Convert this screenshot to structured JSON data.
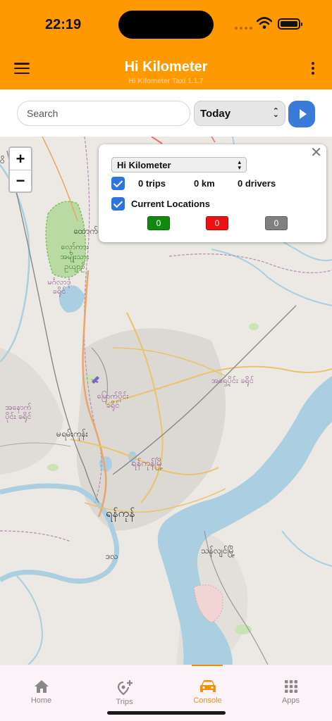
{
  "status_bar": {
    "time": "22:19"
  },
  "header": {
    "title": "Hi Kilometer",
    "subtitle": "Hi Kilometer Taxi 1.1.7"
  },
  "search": {
    "placeholder": "Search",
    "value": ""
  },
  "period": {
    "selected": "Today"
  },
  "map": {
    "zoom_in": "+",
    "zoom_out": "−",
    "labels": {
      "north": "ထောက်",
      "park": "လှော်ကား အမျိုးသား ဥယျာဉ်",
      "mingaladon": "မင်္ဂလာဒုံ ခရိုင်",
      "east_district": "အရှေ့ပိုင်း ခရိုင်",
      "north_district": "မြောက်ပိုင်း ခရိုင်",
      "west_district": "အနောက်ပိုင်း ခရိုင်",
      "mayangone": "မရမ်းကုန်း",
      "new_yangon": "ရန်ကုန်မြို့",
      "yangon": "ရန်ကုန်",
      "dala": "ဒလ",
      "thanlyin": "သန်လျင်မြို့",
      "left_edge": "ဝိ"
    }
  },
  "panel": {
    "company": "Hi Kilometer",
    "trips": "0 trips",
    "km": "0 km",
    "drivers": "0 drivers",
    "current_locations_label": "Current Locations",
    "badges": [
      {
        "value": "0",
        "color": "#0f8a0f"
      },
      {
        "value": "0",
        "color": "#ee1111"
      },
      {
        "value": "0",
        "color": "#808080"
      }
    ]
  },
  "nav": {
    "tabs": [
      {
        "label": "Home",
        "icon": "home-icon"
      },
      {
        "label": "Trips",
        "icon": "location-plus-icon"
      },
      {
        "label": "Console",
        "icon": "car-icon"
      },
      {
        "label": "Apps",
        "icon": "grid-icon"
      }
    ],
    "active": "Console"
  },
  "colors": {
    "accent": "#ff9900",
    "primary": "#3a7ad9",
    "active_tab": "#f29100"
  }
}
